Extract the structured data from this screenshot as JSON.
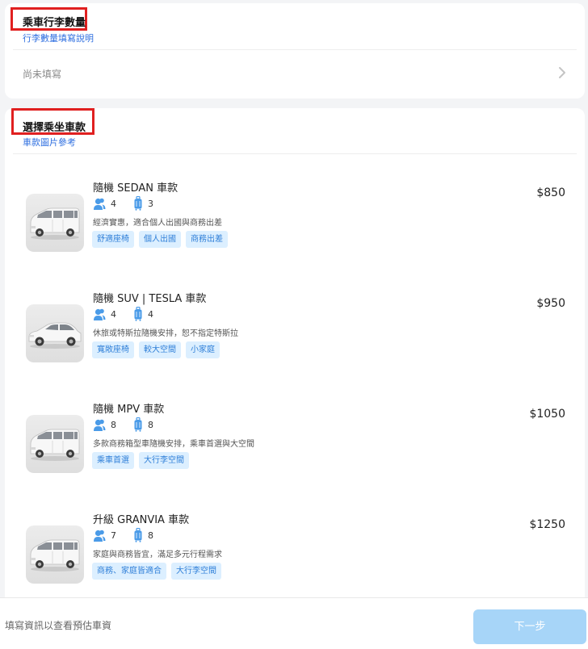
{
  "luggage_section": {
    "title": "乘車行李數量",
    "help_link": "行李數量填寫說明",
    "placeholder": "尚未填寫"
  },
  "vehicle_section": {
    "title": "選擇乘坐車款",
    "help_link": "車款圖片參考"
  },
  "vehicles": [
    {
      "name": "隨機 SEDAN 車款",
      "price": "$850",
      "passengers": "4",
      "luggage": "3",
      "description": "經濟實惠，適合個人出國與商務出差",
      "tags": [
        "舒適座椅",
        "個人出國",
        "商務出差"
      ],
      "image": "van"
    },
    {
      "name": "隨機 SUV | TESLA 車款",
      "price": "$950",
      "passengers": "4",
      "luggage": "4",
      "description": "休旅或特斯拉隨機安排，恕不指定特斯拉",
      "tags": [
        "寬敞座椅",
        "較大空間",
        "小家庭"
      ],
      "image": "tesla"
    },
    {
      "name": "隨機 MPV 車款",
      "price": "$1050",
      "passengers": "8",
      "luggage": "8",
      "description": "多款商務箱型車隨機安排，乘車首選與大空間",
      "tags": [
        "乘車首選",
        "大行李空間"
      ],
      "image": "van"
    },
    {
      "name": "升級 GRANVIA 車款",
      "price": "$1250",
      "passengers": "7",
      "luggage": "8",
      "description": "家庭與商務皆宜，滿足多元行程需求",
      "tags": [
        "商務、家庭皆適合",
        "大行李空間"
      ],
      "image": "van"
    }
  ],
  "footer": {
    "hint": "填寫資訊以查看預估車資",
    "next_label": "下一步"
  },
  "colors": {
    "link": "#2f6fe0",
    "tag_text": "#2f7fd8",
    "tag_bg": "#dcefff",
    "icon_blue": "#4a9be8",
    "highlight": "#e02020",
    "button": "#a7d5f8"
  },
  "icons": {
    "chevron": "chevron-right-icon",
    "passengers": "passengers-icon",
    "luggage": "luggage-icon"
  }
}
